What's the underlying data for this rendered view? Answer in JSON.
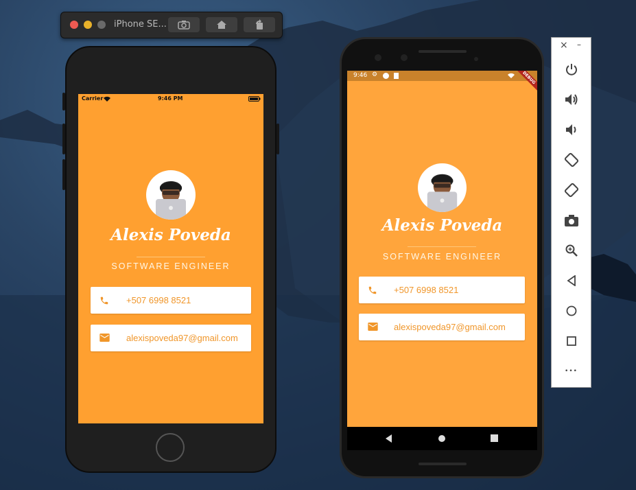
{
  "ios_sim": {
    "title": "iPhone SE...",
    "buttons": [
      "screenshot-icon",
      "home-icon",
      "rotate-icon"
    ]
  },
  "ios_status": {
    "carrier": "Carrier",
    "time": "9:46 PM"
  },
  "android_status": {
    "time": "9:46",
    "debug": "DEBUG"
  },
  "profile": {
    "name": "Alexis Poveda",
    "role": "SOFTWARE ENGINEER",
    "phone": "+507 6998 8521",
    "email": "alexispoveda97@gmail.com",
    "background_color": "#ffa030",
    "accent_color": "#f0962a"
  },
  "emulator_panel": {
    "window_controls": [
      "close-icon",
      "minimize-icon"
    ],
    "buttons": [
      "power-icon",
      "volume-up-icon",
      "volume-down-icon",
      "rotate-left-icon",
      "rotate-right-icon",
      "camera-icon",
      "zoom-icon",
      "back-icon",
      "home-icon",
      "overview-icon",
      "more-icon"
    ],
    "close_glyph": "×",
    "minimize_glyph": "–",
    "more_glyph": "•••"
  }
}
